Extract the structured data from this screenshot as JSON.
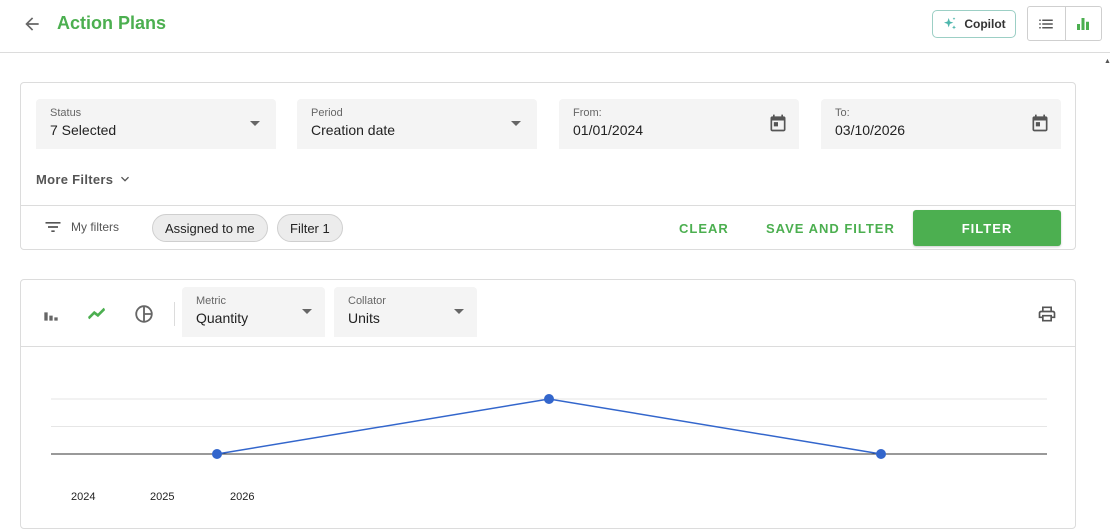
{
  "header": {
    "title": "Action Plans",
    "copilot_label": "Copilot"
  },
  "filters": {
    "status": {
      "label": "Status",
      "value": "7 Selected"
    },
    "period": {
      "label": "Period",
      "value": "Creation date"
    },
    "from": {
      "label": "From:",
      "value": "01/01/2024"
    },
    "to": {
      "label": "To:",
      "value": "03/10/2026"
    },
    "more_filters_label": "More Filters",
    "my_filters_label": "My filters",
    "chips": [
      "Assigned to me",
      "Filter 1"
    ],
    "clear_label": "CLEAR",
    "save_and_filter_label": "SAVE AND FILTER",
    "filter_label": "FILTER"
  },
  "chart_toolbar": {
    "metric": {
      "label": "Metric",
      "value": "Quantity"
    },
    "collator": {
      "label": "Collator",
      "value": "Units"
    }
  },
  "colors": {
    "accent": "#4caf50",
    "series": "#3366cc"
  },
  "chart_data": {
    "type": "line",
    "x_tick_labels": [
      "2024",
      "2025",
      "2026"
    ],
    "series": [
      {
        "values": [
          0,
          2,
          0
        ]
      }
    ],
    "grid": true,
    "legend": "none"
  }
}
